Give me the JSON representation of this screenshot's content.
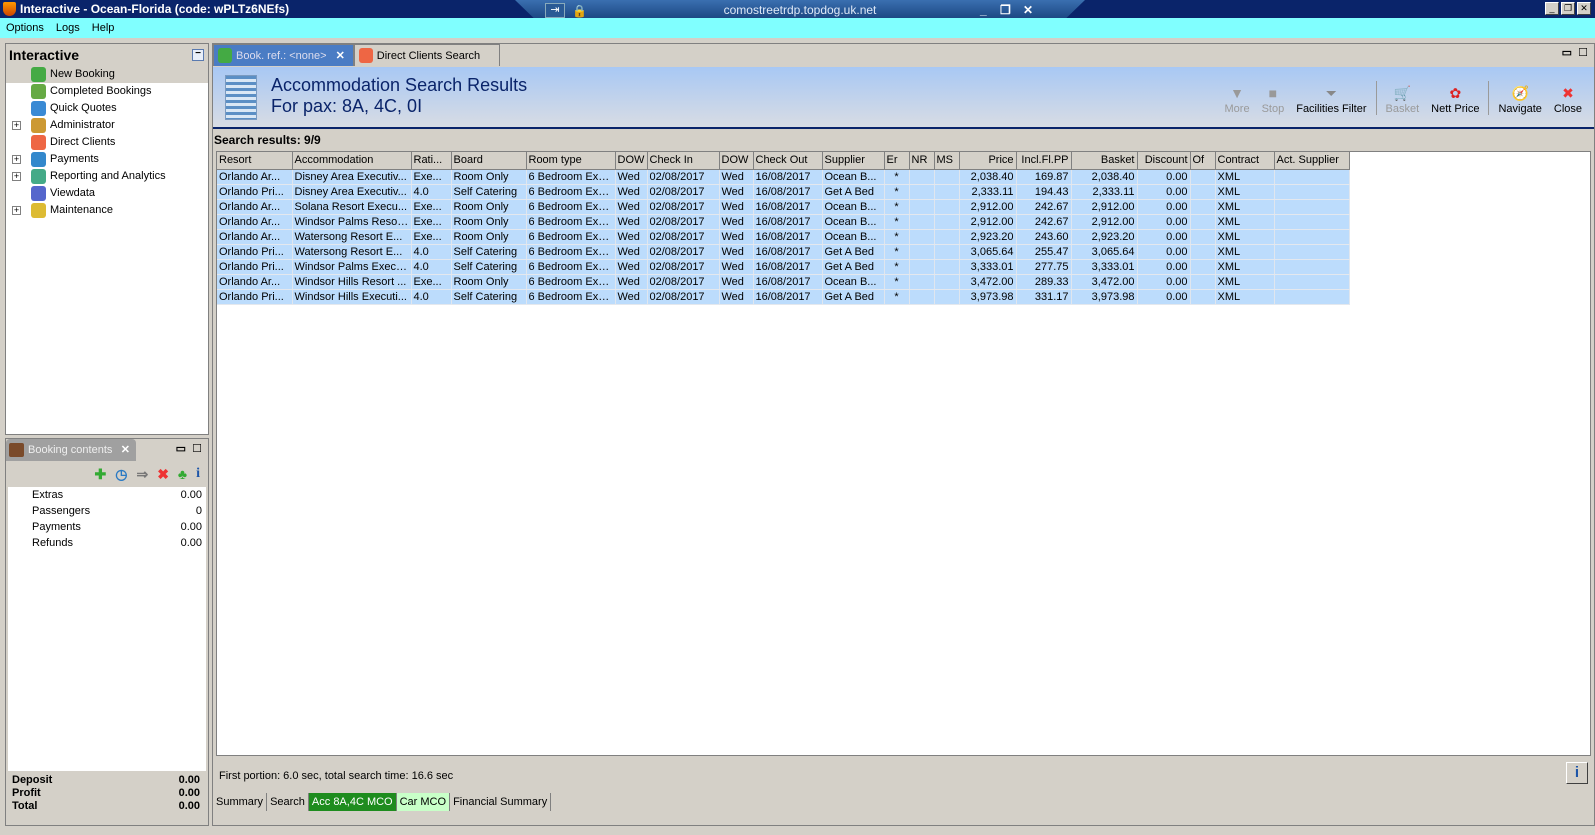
{
  "window": {
    "title": "Interactive - Ocean-Florida (code: wPLTz6NEfs)",
    "rdp_host": "comostreetrdp.topdog.uk.net"
  },
  "menu": [
    "Options",
    "Logs",
    "Help"
  ],
  "nav": {
    "title": "Interactive",
    "items": [
      {
        "label": "New Booking",
        "expandable": false,
        "icon": "palm-tree-icon",
        "selected": true
      },
      {
        "label": "Completed Bookings",
        "expandable": false,
        "icon": "palm-tree-money-icon"
      },
      {
        "label": "Quick Quotes",
        "expandable": false,
        "icon": "clock-icon"
      },
      {
        "label": "Administrator",
        "expandable": true,
        "icon": "runner-icon"
      },
      {
        "label": "Direct Clients",
        "expandable": false,
        "icon": "person-icon"
      },
      {
        "label": "Payments",
        "expandable": true,
        "icon": "payment-card-icon"
      },
      {
        "label": "Reporting and Analytics",
        "expandable": true,
        "icon": "report-icon"
      },
      {
        "label": "Viewdata",
        "expandable": false,
        "icon": "globe-icon"
      },
      {
        "label": "Maintenance",
        "expandable": true,
        "icon": "toolbox-icon"
      }
    ]
  },
  "booking_contents": {
    "tab": "Booking contents",
    "rows": [
      {
        "label": "Extras",
        "value": "0.00"
      },
      {
        "label": "Passengers",
        "value": "0"
      },
      {
        "label": "Payments",
        "value": "0.00"
      },
      {
        "label": "Refunds",
        "value": "0.00"
      }
    ],
    "totals": [
      {
        "label": "Deposit",
        "value": "0.00"
      },
      {
        "label": "Profit",
        "value": "0.00"
      },
      {
        "label": "Total",
        "value": "0.00"
      }
    ]
  },
  "tabs": [
    {
      "label": "Book. ref.: <none>",
      "active": true
    },
    {
      "label": "Direct Clients Search",
      "active": false
    }
  ],
  "header": {
    "title": "Accommodation Search Results",
    "subtitle": "For pax: 8A, 4C, 0I"
  },
  "toolbar": [
    {
      "label": "More",
      "glyph": "▼",
      "disabled": true
    },
    {
      "label": "Stop",
      "glyph": "■",
      "disabled": true
    },
    {
      "label": "Facilities Filter",
      "glyph": "⏷",
      "disabled": false
    },
    "sep",
    {
      "label": "Basket",
      "glyph": "🛒",
      "disabled": true
    },
    {
      "label": "Nett Price",
      "glyph": "✿",
      "disabled": false
    },
    "sep",
    {
      "label": "Navigate",
      "glyph": "🧭",
      "disabled": false
    },
    {
      "label": "Close",
      "glyph": "✖",
      "disabled": false
    }
  ],
  "search_results": "Search results: 9/9",
  "columns": [
    "Resort",
    "Accommodation",
    "Rati...",
    "Board",
    "Room type",
    "DOW",
    "Check In",
    "DOW",
    "Check Out",
    "Supplier",
    "Er",
    "NR",
    "MS",
    "Price",
    "Incl.Fl.PP",
    "Basket",
    "Discount",
    "Of",
    "Contract",
    "Act. Supplier"
  ],
  "rows": [
    [
      "Orlando Ar...",
      "Disney Area Executiv...",
      "Exe...",
      "Room Only",
      "6 Bedroom Exe...",
      "Wed",
      "02/08/2017",
      "Wed",
      "16/08/2017",
      "Ocean B...",
      "*",
      "",
      "",
      "2,038.40",
      "169.87",
      "2,038.40",
      "0.00",
      "",
      "XML",
      ""
    ],
    [
      "Orlando Pri...",
      "Disney Area Executiv...",
      "4.0",
      "Self Catering",
      "6 Bedroom Exe...",
      "Wed",
      "02/08/2017",
      "Wed",
      "16/08/2017",
      "Get A Bed",
      "*",
      "",
      "",
      "2,333.11",
      "194.43",
      "2,333.11",
      "0.00",
      "",
      "XML",
      ""
    ],
    [
      "Orlando Ar...",
      "Solana Resort Execu...",
      "Exe...",
      "Room Only",
      "6 Bedroom Exe...",
      "Wed",
      "02/08/2017",
      "Wed",
      "16/08/2017",
      "Ocean B...",
      "*",
      "",
      "",
      "2,912.00",
      "242.67",
      "2,912.00",
      "0.00",
      "",
      "XML",
      ""
    ],
    [
      "Orlando Ar...",
      "Windsor Palms Resor...",
      "Exe...",
      "Room Only",
      "6 Bedroom Exe...",
      "Wed",
      "02/08/2017",
      "Wed",
      "16/08/2017",
      "Ocean B...",
      "*",
      "",
      "",
      "2,912.00",
      "242.67",
      "2,912.00",
      "0.00",
      "",
      "XML",
      ""
    ],
    [
      "Orlando Ar...",
      "Watersong Resort E...",
      "Exe...",
      "Room Only",
      "6 Bedroom Exe...",
      "Wed",
      "02/08/2017",
      "Wed",
      "16/08/2017",
      "Ocean B...",
      "*",
      "",
      "",
      "2,923.20",
      "243.60",
      "2,923.20",
      "0.00",
      "",
      "XML",
      ""
    ],
    [
      "Orlando Pri...",
      "Watersong Resort E...",
      "4.0",
      "Self Catering",
      "6 Bedroom Exe...",
      "Wed",
      "02/08/2017",
      "Wed",
      "16/08/2017",
      "Get A Bed",
      "*",
      "",
      "",
      "3,065.64",
      "255.47",
      "3,065.64",
      "0.00",
      "",
      "XML",
      ""
    ],
    [
      "Orlando Pri...",
      "Windsor Palms Execu...",
      "4.0",
      "Self Catering",
      "6 Bedroom Exe...",
      "Wed",
      "02/08/2017",
      "Wed",
      "16/08/2017",
      "Get A Bed",
      "*",
      "",
      "",
      "3,333.01",
      "277.75",
      "3,333.01",
      "0.00",
      "",
      "XML",
      ""
    ],
    [
      "Orlando Ar...",
      "Windsor Hills Resort ...",
      "Exe...",
      "Room Only",
      "6 Bedroom Exe...",
      "Wed",
      "02/08/2017",
      "Wed",
      "16/08/2017",
      "Ocean B...",
      "*",
      "",
      "",
      "3,472.00",
      "289.33",
      "3,472.00",
      "0.00",
      "",
      "XML",
      ""
    ],
    [
      "Orlando Pri...",
      "Windsor Hills Executi...",
      "4.0",
      "Self Catering",
      "6 Bedroom Exe...",
      "Wed",
      "02/08/2017",
      "Wed",
      "16/08/2017",
      "Get A Bed",
      "*",
      "",
      "",
      "3,973.98",
      "331.17",
      "3,973.98",
      "0.00",
      "",
      "XML",
      ""
    ]
  ],
  "status": "First portion: 6.0 sec, total search time: 16.6 sec",
  "bottom_tabs": [
    "Summary",
    "Search",
    "Acc 8A,4C MCO",
    "Car MCO",
    "Financial Summary"
  ]
}
